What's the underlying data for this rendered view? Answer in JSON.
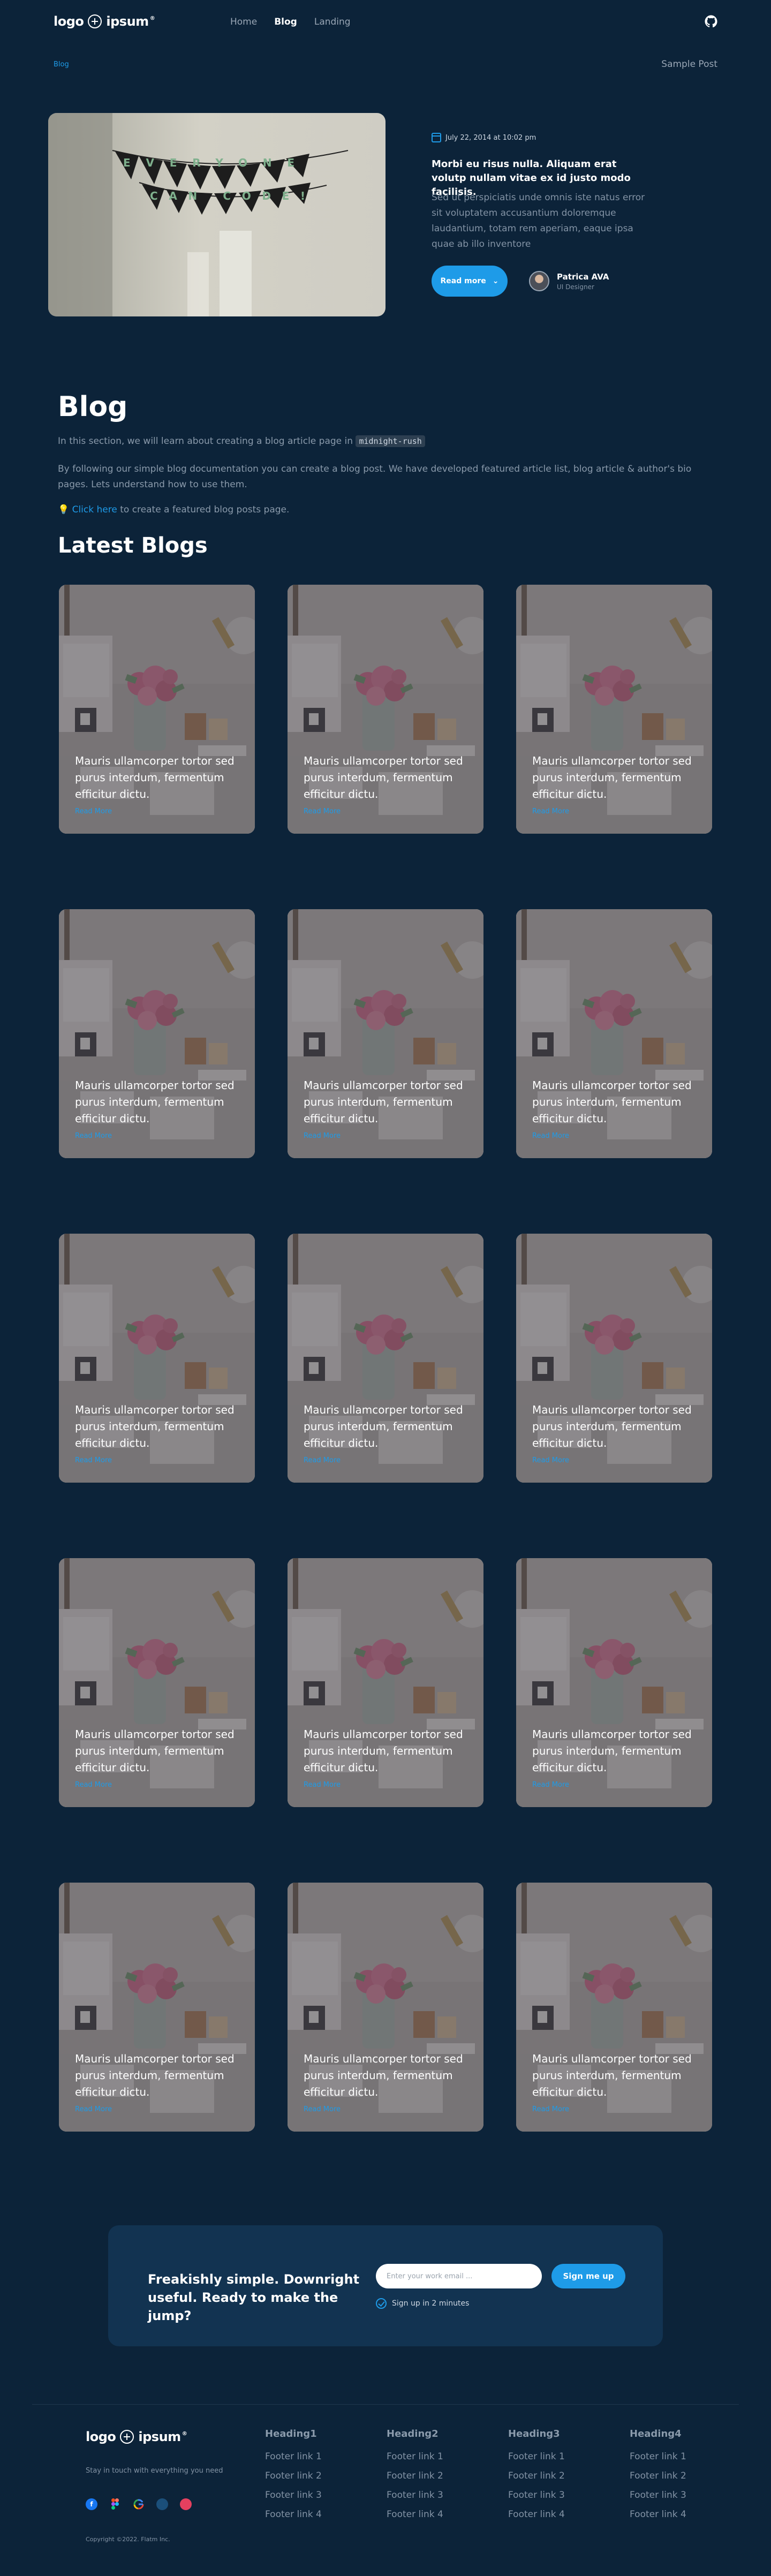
{
  "header": {
    "logo_text": "logo",
    "logo_suffix": "ipsum",
    "logo_tm": "®",
    "nav": [
      {
        "label": "Home",
        "active": false
      },
      {
        "label": "Blog",
        "active": true
      },
      {
        "label": "Landing",
        "active": false
      }
    ]
  },
  "breadcrumb": {
    "current": "Blog",
    "right_label": "Sample Post"
  },
  "hero": {
    "banner_text": [
      "EVERYONE",
      "CAN CODE!"
    ],
    "date": "July 22, 2014 at 10:02 pm",
    "title": "Morbi eu risus nulla. Aliquam erat volutp nullam vitae ex id justo modo facilisis.",
    "description": "Sed ut perspiciatis unde omnis iste natus error sit voluptatem accusantium doloremque laudantium, totam rem aperiam, eaque ipsa quae ab illo inventore",
    "read_more": "Read more",
    "author_name": "Patrica AVA",
    "author_role": "UI Designer"
  },
  "blog": {
    "title": "Blog",
    "intro_1": "In this section, we will learn about creating a blog article page in",
    "intro_code": "midnight-rush",
    "intro_2": "By following our simple blog documentation you can create a blog post. We have developed featured article list, blog article & author's bio pages. Lets understand how to use them.",
    "intro_3_icon": "💡",
    "intro_3_link": "Click here",
    "intro_3_rest": "to create a featured blog posts page.",
    "latest_title": "Latest Blogs"
  },
  "cards": [
    {
      "text": "Mauris ullamcorper tortor sed purus interdum, fermentum efficitur dictu.",
      "link": "Read More"
    },
    {
      "text": "Mauris ullamcorper tortor sed purus interdum, fermentum efficitur dictu.",
      "link": "Read More"
    },
    {
      "text": "Mauris ullamcorper tortor sed purus interdum, fermentum efficitur dictu.",
      "link": "Read More"
    },
    {
      "text": "Mauris ullamcorper tortor sed purus interdum, fermentum efficitur dictu.",
      "link": "Read More"
    },
    {
      "text": "Mauris ullamcorper tortor sed purus interdum, fermentum efficitur dictu.",
      "link": "Read More"
    },
    {
      "text": "Mauris ullamcorper tortor sed purus interdum, fermentum efficitur dictu.",
      "link": "Read More"
    },
    {
      "text": "Mauris ullamcorper tortor sed purus interdum, fermentum efficitur dictu.",
      "link": "Read More"
    },
    {
      "text": "Mauris ullamcorper tortor sed purus interdum, fermentum efficitur dictu.",
      "link": "Read More"
    },
    {
      "text": "Mauris ullamcorper tortor sed purus interdum, fermentum efficitur dictu.",
      "link": "Read More"
    },
    {
      "text": "Mauris ullamcorper tortor sed purus interdum, fermentum efficitur dictu.",
      "link": "Read More"
    },
    {
      "text": "Mauris ullamcorper tortor sed purus interdum, fermentum efficitur dictu.",
      "link": "Read More"
    },
    {
      "text": "Mauris ullamcorper tortor sed purus interdum, fermentum efficitur dictu.",
      "link": "Read More"
    },
    {
      "text": "Mauris ullamcorper tortor sed purus interdum, fermentum efficitur dictu.",
      "link": "Read More"
    },
    {
      "text": "Mauris ullamcorper tortor sed purus interdum, fermentum efficitur dictu.",
      "link": "Read More"
    },
    {
      "text": "Mauris ullamcorper tortor sed purus interdum, fermentum efficitur dictu.",
      "link": "Read More"
    }
  ],
  "subscribe": {
    "title": "Freakishly simple. Downright useful. Ready to make the jump?",
    "placeholder": "Enter your work email ...",
    "button": "Sign me up",
    "note": "Sign up in 2 minutes"
  },
  "footer": {
    "tagline": "Stay in touch with everything you need",
    "socials": [
      "facebook-icon",
      "figma-icon",
      "google-icon",
      "dribbble-icon",
      "instagram-icon"
    ],
    "copyright": "Copyright ©2022. Flatm Inc.",
    "columns": [
      {
        "heading": "Heading1",
        "links": [
          "Footer link 1",
          "Footer link 2",
          "Footer link 3",
          "Footer link 4"
        ]
      },
      {
        "heading": "Heading2",
        "links": [
          "Footer link 1",
          "Footer link 2",
          "Footer link 3",
          "Footer link 4"
        ]
      },
      {
        "heading": "Heading3",
        "links": [
          "Footer link 1",
          "Footer link 2",
          "Footer link 3",
          "Footer link 4"
        ]
      },
      {
        "heading": "Heading4",
        "links": [
          "Footer link 1",
          "Footer link 2",
          "Footer link 3",
          "Footer link 4"
        ]
      }
    ]
  },
  "colors": {
    "background": "#0c2339",
    "accent": "#1e9be8",
    "muted_text": "#8393a5",
    "subscribe_bg": "#123351"
  }
}
